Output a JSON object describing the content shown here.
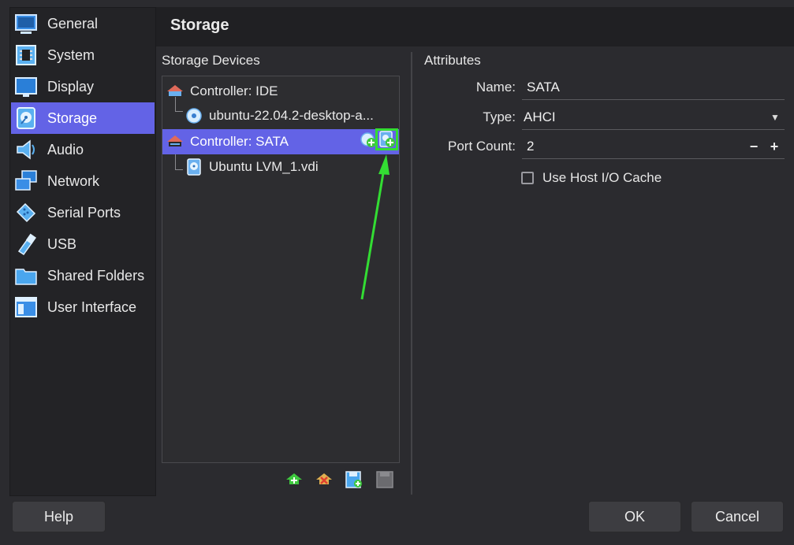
{
  "sidebar": {
    "items": [
      {
        "label": "General",
        "icon": "general-monitor-icon"
      },
      {
        "label": "System",
        "icon": "chip-icon"
      },
      {
        "label": "Display",
        "icon": "display-monitor-icon"
      },
      {
        "label": "Storage",
        "icon": "disk-icon",
        "active": true
      },
      {
        "label": "Audio",
        "icon": "speaker-icon"
      },
      {
        "label": "Network",
        "icon": "network-icon"
      },
      {
        "label": "Serial Ports",
        "icon": "serial-port-icon"
      },
      {
        "label": "USB",
        "icon": "usb-icon"
      },
      {
        "label": "Shared Folders",
        "icon": "folder-icon"
      },
      {
        "label": "User Interface",
        "icon": "window-icon"
      }
    ]
  },
  "header": {
    "title": "Storage"
  },
  "storage_devices": {
    "label": "Storage Devices",
    "tree": [
      {
        "label": "Controller: IDE",
        "icon": "ide-controller-icon"
      },
      {
        "label": "ubuntu-22.04.2-desktop-a...",
        "icon": "optical-disc-icon"
      },
      {
        "label": "Controller: SATA",
        "icon": "sata-controller-icon",
        "selected": true
      },
      {
        "label": "Ubuntu LVM_1.vdi",
        "icon": "hard-disk-icon"
      }
    ]
  },
  "attributes": {
    "label": "Attributes",
    "name_label": "Name:",
    "name_value": "SATA",
    "type_label": "Type:",
    "type_value": "AHCI",
    "port_count_label": "Port Count:",
    "port_count_value": "2",
    "stepper_minus": "−",
    "stepper_plus": "+",
    "host_io_cache_label": "Use Host I/O Cache",
    "host_io_cache_checked": false
  },
  "buttons": {
    "help": "Help",
    "ok": "OK",
    "cancel": "Cancel"
  },
  "colors": {
    "accent": "#6363e6",
    "annotation": "#33dd33",
    "background": "#2b2b2f"
  }
}
